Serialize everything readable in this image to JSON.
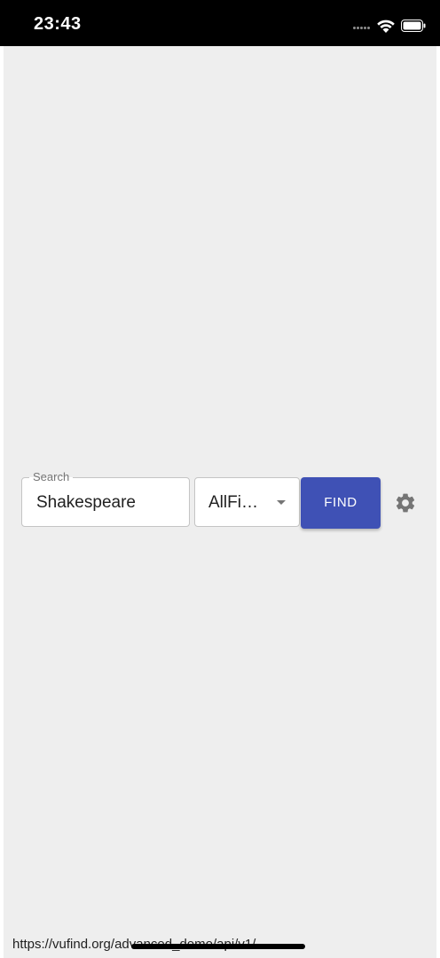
{
  "status_bar": {
    "time": "23:43",
    "icons": [
      "cellular-dots-icon",
      "wifi-icon",
      "battery-icon"
    ]
  },
  "search": {
    "label": "Search",
    "value": "Shakespeare"
  },
  "field_select": {
    "selected": "AllFi…",
    "icon": "caret-down-icon"
  },
  "find_button": {
    "label": "FIND",
    "color": "#3f51b5"
  },
  "settings": {
    "icon": "gear-icon"
  },
  "footer": {
    "url": "https://vufind.org/advanced_demo/api/v1/"
  },
  "colors": {
    "background": "#eeeeee",
    "accent": "#3f51b5"
  }
}
